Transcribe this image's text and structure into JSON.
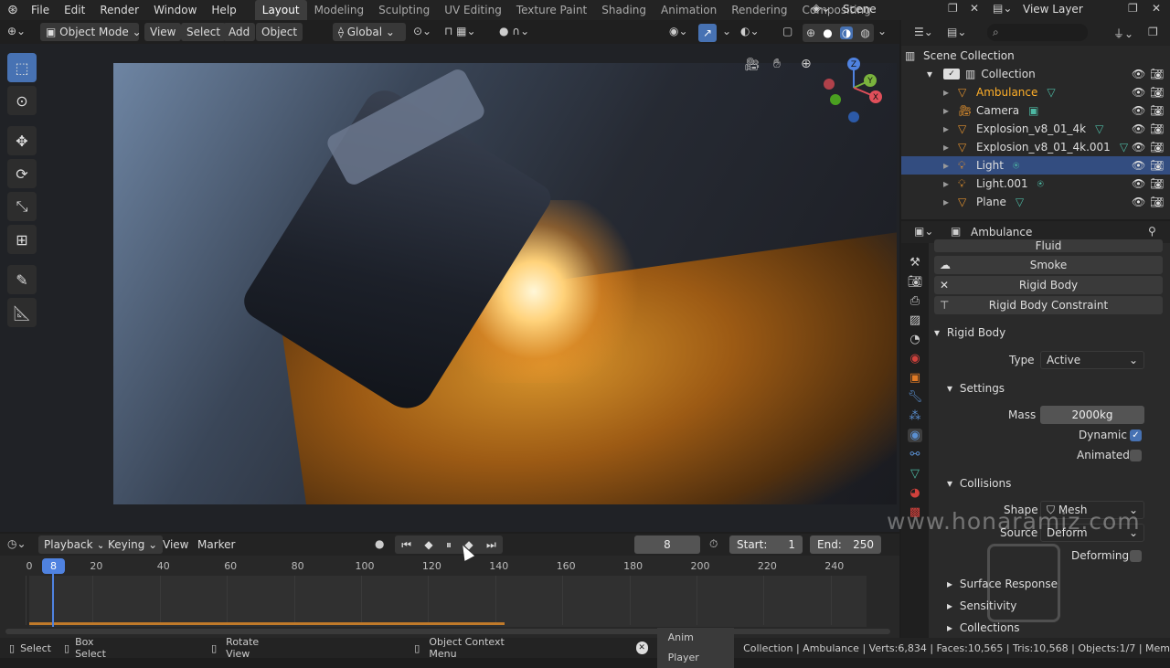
{
  "menu": {
    "items": [
      "File",
      "Edit",
      "Render",
      "Window",
      "Help"
    ]
  },
  "workspaces": [
    "Layout",
    "Modeling",
    "Sculpting",
    "UV Editing",
    "Texture Paint",
    "Shading",
    "Animation",
    "Rendering",
    "Compositing"
  ],
  "scene": {
    "label": "Scene"
  },
  "view_layer": {
    "label": "View Layer"
  },
  "viewport": {
    "mode": "Object Mode",
    "menus": [
      "View",
      "Select",
      "Add",
      "Object"
    ],
    "orientation": "Global",
    "gizmo_axes": {
      "z": "Z",
      "y": "Y",
      "x": "X"
    }
  },
  "outliner": {
    "root": "Scene Collection",
    "collection": "Collection",
    "items": [
      {
        "name": "Ambulance",
        "type": "mesh",
        "active": true
      },
      {
        "name": "Camera",
        "type": "camera"
      },
      {
        "name": "Explosion_v8_01_4k",
        "type": "mesh"
      },
      {
        "name": "Explosion_v8_01_4k.001",
        "type": "mesh"
      },
      {
        "name": "Light",
        "type": "light",
        "selected": true
      },
      {
        "name": "Light.001",
        "type": "light"
      },
      {
        "name": "Plane",
        "type": "mesh"
      }
    ]
  },
  "properties": {
    "object_name": "Ambulance",
    "physics_buttons": [
      "Fluid",
      "Smoke",
      "Rigid Body",
      "Rigid Body Constraint"
    ],
    "rigid_body": {
      "title": "Rigid Body",
      "type_label": "Type",
      "type_value": "Active",
      "settings_title": "Settings",
      "mass_label": "Mass",
      "mass_value": "2000kg",
      "dynamic_label": "Dynamic",
      "dynamic": true,
      "animated_label": "Animated",
      "animated": false,
      "collisions_title": "Collisions",
      "shape_label": "Shape",
      "shape_value": "Mesh",
      "source_label": "Source",
      "source_value": "Deform",
      "deforming_label": "Deforming",
      "deforming": false,
      "subsections": [
        "Surface Response",
        "Sensitivity",
        "Collections"
      ]
    }
  },
  "timeline": {
    "menus": [
      "Playback",
      "Keying",
      "View",
      "Marker"
    ],
    "current_frame": "8",
    "start_label": "Start:",
    "start": "1",
    "end_label": "End:",
    "end": "250",
    "ticks": [
      "0",
      "20",
      "40",
      "60",
      "80",
      "100",
      "120",
      "140",
      "160",
      "180",
      "200",
      "220",
      "240"
    ],
    "playhead_label": "8"
  },
  "status_bar": {
    "select": "Select",
    "box_select": "Box Select",
    "rotate": "Rotate View",
    "context": "Object Context Menu",
    "anim": "Anim Player",
    "stats": "Collection | Ambulance | Verts:6,834 | Faces:10,565 | Tris:10,568 | Objects:1/7 | Mem"
  },
  "watermark": "www.honaramiz.com",
  "colors": {
    "accent": "#4772b3",
    "selected_row": "#334d80",
    "active_text": "#ffaf29",
    "timeline_range": "#c07a2a"
  }
}
